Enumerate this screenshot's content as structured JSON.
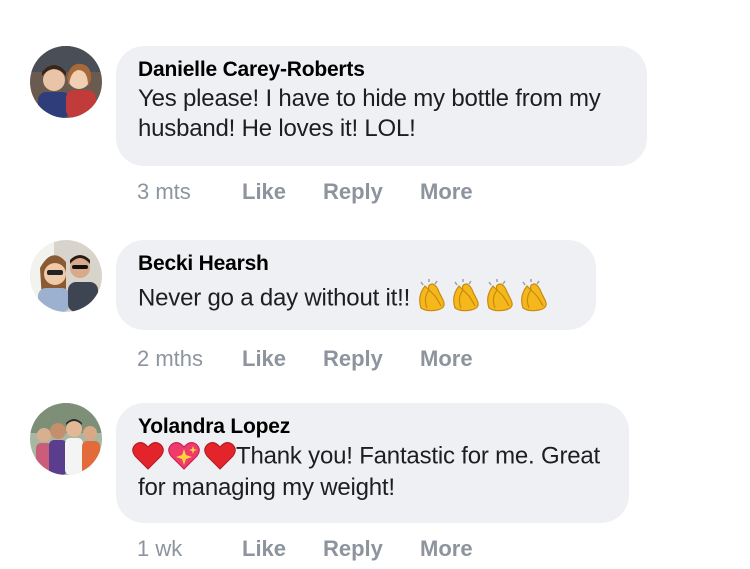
{
  "comments": [
    {
      "author": "Danielle Carey-Roberts",
      "text": "Yes please! I have to hide my bottle from my husband! He loves it! LOL!",
      "time": "3 mts",
      "like": "Like",
      "reply": "Reply",
      "more": "More",
      "avatar_icon": "profile-photo"
    },
    {
      "author": "Becki Hearsh",
      "text_before": "Never go a day without it!!",
      "emoji": [
        "clapping-hands",
        "clapping-hands",
        "clapping-hands",
        "clapping-hands"
      ],
      "time": "2 mths",
      "like": "Like",
      "reply": "Reply",
      "more": "More",
      "avatar_icon": "profile-photo"
    },
    {
      "author": "Yolandra Lopez",
      "emoji": [
        "red-heart",
        "sparkling-heart",
        "red-heart"
      ],
      "text": "Thank you! Fantastic for me. Great for managing my weight!",
      "time": "1 wk",
      "like": "Like",
      "reply": "Reply",
      "more": "More",
      "avatar_icon": "profile-photo"
    }
  ],
  "colors": {
    "bubble": "#eff0f3",
    "meta": "#8d949e",
    "text": "#1c1e21"
  }
}
